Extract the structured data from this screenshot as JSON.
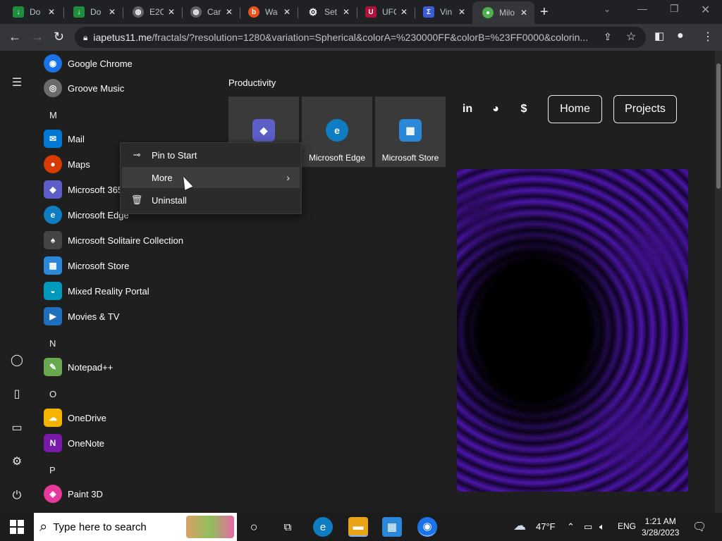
{
  "browser": {
    "tabs": [
      {
        "label": "Do",
        "icon": "download-icon",
        "color": "#1e8e3e"
      },
      {
        "label": "Do",
        "icon": "download-icon",
        "color": "#1e8e3e"
      },
      {
        "label": "E2C",
        "icon": "globe-icon",
        "color": "#5f6368"
      },
      {
        "label": "Car",
        "icon": "globe-icon",
        "color": "#5f6368"
      },
      {
        "label": "Wa",
        "icon": "brave-b-icon",
        "color": "#e8531c"
      },
      {
        "label": "Set",
        "icon": "gear-icon",
        "color": "#5f6368"
      },
      {
        "label": "UFC",
        "icon": "ufc-icon",
        "color": "#b0133a"
      },
      {
        "label": "Vin",
        "icon": "vin-icon",
        "color": "#3b5bdb"
      },
      {
        "label": "Milo",
        "icon": "milo-icon",
        "color": "#4caf50"
      }
    ],
    "url_host": "iapetus11.me",
    "url_rest": "/fractals/?resolution=1280&variation=Spherical&colorA=%230000FF&colorB=%23FF0000&colorin..."
  },
  "webpage": {
    "nav_links": [
      "Home",
      "Projects"
    ],
    "social_icons": [
      "linkedin-icon",
      "discord-icon",
      "dollar-icon"
    ]
  },
  "start_menu": {
    "apps": [
      {
        "label": "Google Chrome",
        "color": "#1a73e8"
      },
      {
        "label": "Groove Music",
        "color": "#6b6b6b"
      },
      {
        "label": "Mail",
        "color": "#0078d4"
      },
      {
        "label": "Maps",
        "color": "#d83b01"
      },
      {
        "label": "Microsoft 365",
        "color": "#5b5fc7"
      },
      {
        "label": "Microsoft Edge",
        "color": "#0f7dc2"
      },
      {
        "label": "Microsoft Solitaire Collection",
        "color": "#444444"
      },
      {
        "label": "Microsoft Store",
        "color": "#2b88d8"
      },
      {
        "label": "Mixed Reality Portal",
        "color": "#0099bc"
      },
      {
        "label": "Movies & TV",
        "color": "#1f6fbf"
      },
      {
        "label": "Notepad++",
        "color": "#6aa84f"
      },
      {
        "label": "OneDrive",
        "color": "#f4b400"
      },
      {
        "label": "OneNote",
        "color": "#7719aa"
      },
      {
        "label": "Paint 3D",
        "color": "#e5399b"
      }
    ],
    "letters": [
      "M",
      "N",
      "O",
      "P"
    ],
    "productivity_header": "Productivity",
    "tiles": [
      {
        "label": "",
        "color": "#5b5fc7"
      },
      {
        "label": "Microsoft Edge",
        "color": "#0f7dc2"
      },
      {
        "label": "Microsoft Store",
        "color": "#2b88d8"
      }
    ]
  },
  "context_menu": {
    "items": [
      {
        "label": "Pin to Start",
        "icon": "pin-icon"
      },
      {
        "label": "More",
        "icon": ""
      },
      {
        "label": "Uninstall",
        "icon": "trash-icon"
      }
    ]
  },
  "taskbar": {
    "search_placeholder": "Type here to search",
    "weather": "47°F",
    "language": "ENG",
    "time": "1:21 AM",
    "date": "3/28/2023"
  }
}
